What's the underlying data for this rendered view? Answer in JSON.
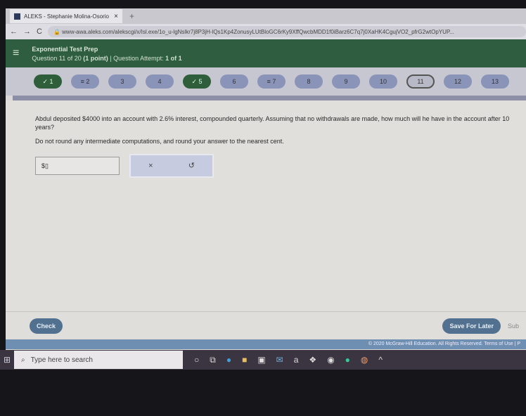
{
  "browser": {
    "tab_title": "ALEKS - Stephanie Molina-Osorio",
    "url": "www-awa.aleks.com/alekscgi/x/Isl.exe/1o_u-lgNslkr7j8P3jH-lQs1Kp4ZonusyLUtBloGC6rKy9XffQwcbMDD1f0iBarz6C7q7j0XaHK4CgujVO2_pfrG2wtOpYUP..."
  },
  "header": {
    "title": "Exponential Test Prep",
    "question": "Question 11 of 20",
    "points": "(1 point)",
    "attempt_label": "Question Attempt:",
    "attempt": "1 of 1"
  },
  "questions": [
    {
      "label": "✓ 1",
      "state": "done"
    },
    {
      "label": "≡ 2",
      "state": "flag"
    },
    {
      "label": "3",
      "state": ""
    },
    {
      "label": "4",
      "state": ""
    },
    {
      "label": "✓ 5",
      "state": "done"
    },
    {
      "label": "6",
      "state": ""
    },
    {
      "label": "≡ 7",
      "state": "flag"
    },
    {
      "label": "8",
      "state": ""
    },
    {
      "label": "9",
      "state": ""
    },
    {
      "label": "10",
      "state": ""
    },
    {
      "label": "11",
      "state": "current"
    },
    {
      "label": "12",
      "state": ""
    },
    {
      "label": "13",
      "state": ""
    }
  ],
  "content": {
    "question": "Abdul deposited $4000 into an account with 2.6% interest, compounded quarterly. Assuming that no withdrawals are made, how much will he have in the account after 10 years?",
    "instruction": "Do not round any intermediate computations, and round your answer to the nearest cent.",
    "answer_prefix": "$",
    "answer_value": ""
  },
  "tools": {
    "clear": "×",
    "undo": "↺"
  },
  "footer": {
    "check": "Check",
    "save": "Save For Later",
    "submit": "Sub",
    "copyright": "© 2020 McGraw-Hill Education. All Rights Reserved.   Terms of Use  |  P"
  },
  "taskbar": {
    "search_placeholder": "Type here to search"
  }
}
